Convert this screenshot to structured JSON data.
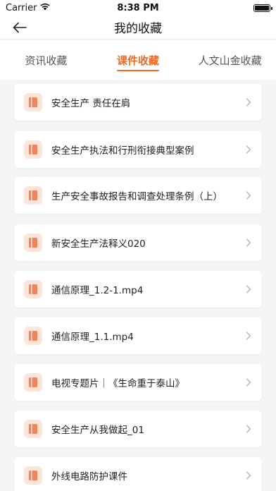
{
  "status_bar": {
    "carrier": "Carrier",
    "time": "8:38 PM"
  },
  "nav": {
    "title": "我的收藏"
  },
  "tabs": [
    {
      "label": "资讯收藏",
      "active": false
    },
    {
      "label": "课件收藏",
      "active": true
    },
    {
      "label": "人文山金收藏",
      "active": false
    }
  ],
  "colors": {
    "accent": "#f06a24",
    "icon_bg": "#fde5da",
    "icon_fg": "#f2845a"
  },
  "items": [
    {
      "title": "安全生产 责任在肩"
    },
    {
      "title": "安全生产执法和行刑衔接典型案例"
    },
    {
      "title": "生产安全事故报告和调查处理条例（上）"
    },
    {
      "title": "新安全生产法释义020"
    },
    {
      "title": "通信原理_1.2-1.mp4"
    },
    {
      "title": "通信原理_1.1.mp4"
    },
    {
      "title": "电视专题片｜《生命重于泰山》"
    },
    {
      "title": "安全生产从我做起_01"
    },
    {
      "title": "外线电路防护课件"
    }
  ]
}
